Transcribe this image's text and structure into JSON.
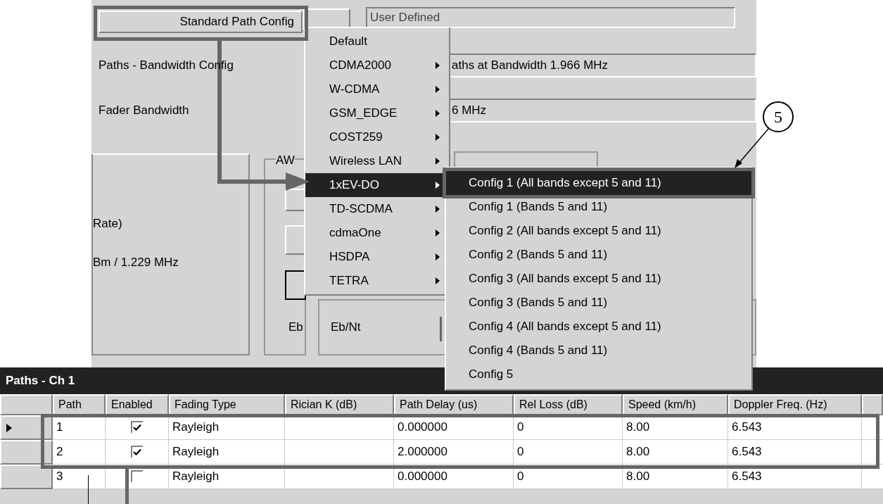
{
  "config_button": {
    "label": "Standard Path Config"
  },
  "config_field": {
    "value": "User Defined"
  },
  "fields": [
    {
      "label": "Paths - Bandwidth Config",
      "value": "aths at Bandwidth 1.966 MHz"
    },
    {
      "label": "Fader Bandwidth",
      "value": "6 MHz"
    }
  ],
  "group_texts": [
    "Rate)",
    "Bm / 1.229 MHz"
  ],
  "awgn_group": {
    "title": "AW",
    "label": "Eb"
  },
  "eb_nt_label": "Eb/Nt",
  "menu": {
    "items": [
      {
        "label": "Default",
        "submenu": false,
        "selected": false
      },
      {
        "label": "CDMA2000",
        "submenu": true,
        "selected": false
      },
      {
        "label": "W-CDMA",
        "submenu": true,
        "selected": false
      },
      {
        "label": "GSM_EDGE",
        "submenu": true,
        "selected": false
      },
      {
        "label": "COST259",
        "submenu": true,
        "selected": false
      },
      {
        "label": "Wireless LAN",
        "submenu": true,
        "selected": false
      },
      {
        "label": "1xEV-DO",
        "submenu": true,
        "selected": true
      },
      {
        "label": "TD-SCDMA",
        "submenu": true,
        "selected": false
      },
      {
        "label": "cdmaOne",
        "submenu": true,
        "selected": false
      },
      {
        "label": "HSDPA",
        "submenu": true,
        "selected": false
      },
      {
        "label": "TETRA",
        "submenu": true,
        "selected": false
      }
    ]
  },
  "submenu": {
    "items": [
      {
        "label": "Config 1 (All bands except 5 and 11)",
        "selected": true
      },
      {
        "label": "Config 1 (Bands 5 and 11)",
        "selected": false
      },
      {
        "label": "Config 2 (All bands except 5 and 11)",
        "selected": false
      },
      {
        "label": "Config 2 (Bands 5 and 11)",
        "selected": false
      },
      {
        "label": "Config 3 (All bands except 5 and 11)",
        "selected": false
      },
      {
        "label": "Config 3 (Bands 5 and 11)",
        "selected": false
      },
      {
        "label": "Config 4 (All bands except 5 and 11)",
        "selected": false
      },
      {
        "label": "Config 4 (Bands 5 and 11)",
        "selected": false
      },
      {
        "label": "Config 5",
        "selected": false
      }
    ]
  },
  "callout": {
    "number": "5"
  },
  "table": {
    "title": "Paths - Ch 1",
    "columns": [
      "Path",
      "Enabled",
      "Fading Type",
      "Rician K (dB)",
      "Path Delay (us)",
      "Rel Loss (dB)",
      "Speed (km/h)",
      "Doppler Freq. (Hz)"
    ],
    "rows": [
      {
        "selected": true,
        "path": "1",
        "enabled": true,
        "fading_type": "Rayleigh",
        "path_delay": "0.000000",
        "rel_loss": "0",
        "speed": "8.00",
        "doppler": "6.543"
      },
      {
        "selected": false,
        "path": "2",
        "enabled": true,
        "fading_type": "Rayleigh",
        "path_delay": "2.000000",
        "rel_loss": "0",
        "speed": "8.00",
        "doppler": "6.543"
      },
      {
        "selected": false,
        "path": "3",
        "enabled": false,
        "fading_type": "Rayleigh",
        "path_delay": "0.000000",
        "rel_loss": "0",
        "speed": "8.00",
        "doppler": "6.543"
      }
    ]
  }
}
